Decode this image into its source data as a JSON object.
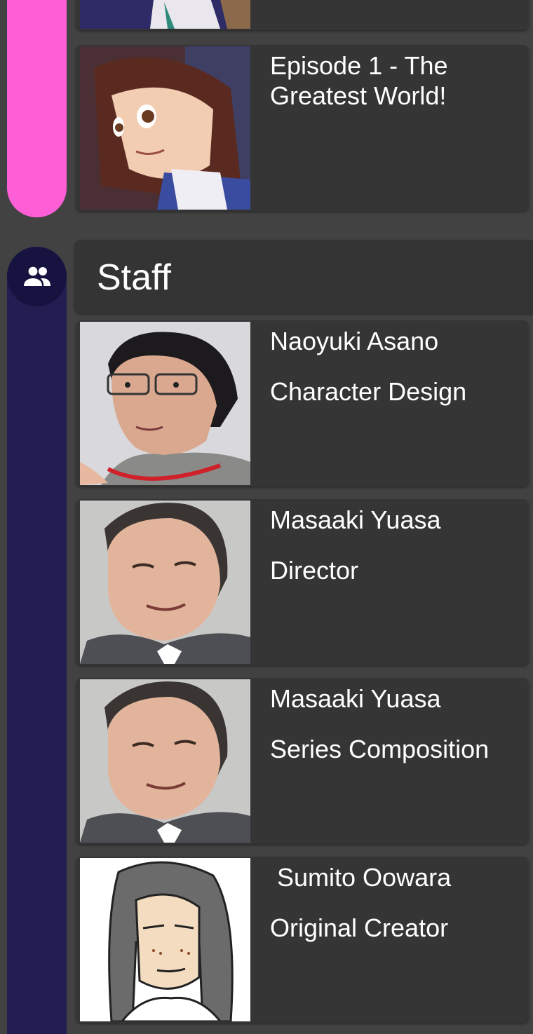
{
  "episodes": [
    {
      "title": ""
    },
    {
      "title": "Episode 1 - The Greatest World!"
    }
  ],
  "staff_section": {
    "icon": "people-icon",
    "title": "Staff"
  },
  "staff": [
    {
      "name": "Naoyuki Asano",
      "role": "Character Design"
    },
    {
      "name": "Masaaki Yuasa",
      "role": "Director"
    },
    {
      "name": "Masaaki Yuasa",
      "role": "Series Composition"
    },
    {
      "name": " Sumito Oowara",
      "role": "Original Creator"
    }
  ],
  "colors": {
    "background": "#424242",
    "card": "#353535",
    "episodes_rail": "#ff5fd6",
    "staff_rail": "#231e52"
  }
}
